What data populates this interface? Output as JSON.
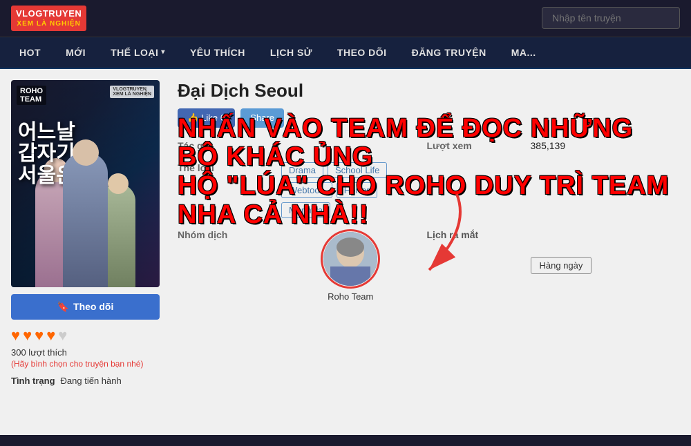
{
  "header": {
    "logo_line1": "VLOGTRUYEN",
    "logo_line2": "XEM LÀ NGHIỆN",
    "search_placeholder": "Nhập tên truyện"
  },
  "nav": {
    "items": [
      {
        "label": "HOT"
      },
      {
        "label": "MỚI"
      },
      {
        "label": "THỂ LOẠI",
        "has_arrow": true
      },
      {
        "label": "YÊU THÍCH"
      },
      {
        "label": "LỊCH SỬ"
      },
      {
        "label": "THEO DÕI"
      },
      {
        "label": "ĐĂNG TRUYỆN"
      },
      {
        "label": "MA..."
      }
    ]
  },
  "manga": {
    "title": "Đại Dịch Seoul",
    "cover": {
      "team_label": "ROHO\nTEAM",
      "site_label": "VLOGTRUYEN\nXEM LÀ NGHIỆN",
      "korean_title": "어느날\n갑자기\n서울은"
    },
    "like_count": "0",
    "like_label": "Like",
    "share_label": "Share",
    "author_label": "Tác giả",
    "author_value": "",
    "views_label": "Lượt xem",
    "views_value": "385,139",
    "genre_label": "Thể loại",
    "genres": [
      "Drama",
      "School Life",
      "Webtoon",
      "Horror",
      "Manhwa"
    ],
    "group_label": "Nhóm dịch",
    "group_name": "Roho Team",
    "schedule_label": "Lịch ra mắt",
    "schedule_value": "Hàng ngày",
    "follow_label": "Theo dõi",
    "hearts": 4,
    "hearts_total": 5,
    "likes_count": "300 lượt thích",
    "likes_prompt": "(Hãy bình chọn cho truyện bạn nhé)",
    "status_label": "Tình trạng",
    "status_value": "Đang tiến hành",
    "promo_text_line1": "NHẤN VÀO TEAM ĐỂ ĐỌC NHỮNG BỘ KHÁC ỦNG",
    "promo_text_line2": "HỘ \"LÚA\" CHO ROHO DUY TRÌ TEAM NHA CẢ NHÀ!!"
  }
}
